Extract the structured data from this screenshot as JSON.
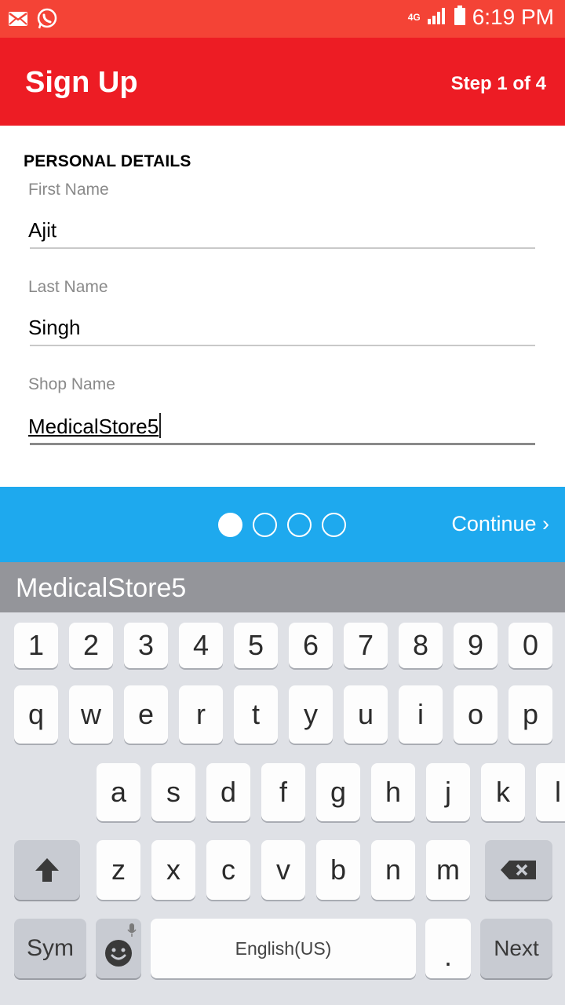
{
  "status_bar": {
    "time": "6:19 PM",
    "network": "4G",
    "left_icons": [
      "mail-icon",
      "whatsapp-icon"
    ],
    "right_icons": [
      "signal-icon",
      "battery-icon"
    ]
  },
  "toolbar": {
    "title": "Sign Up",
    "step": "Step 1 of 4"
  },
  "form": {
    "section_title": "PERSONAL DETAILS",
    "fields": [
      {
        "label": "First Name",
        "value": "Ajit"
      },
      {
        "label": "Last Name",
        "value": "Singh"
      },
      {
        "label": "Shop Name",
        "value": "MedicalStore5"
      }
    ]
  },
  "pager": {
    "total_steps": 4,
    "current_step": 1,
    "continue_label": "Continue ›"
  },
  "suggestion": {
    "text": "MedicalStore5"
  },
  "keyboard": {
    "row_numbers": [
      "1",
      "2",
      "3",
      "4",
      "5",
      "6",
      "7",
      "8",
      "9",
      "0"
    ],
    "row_top": [
      "q",
      "w",
      "e",
      "r",
      "t",
      "y",
      "u",
      "i",
      "o",
      "p"
    ],
    "row_middle": [
      "a",
      "s",
      "d",
      "f",
      "g",
      "h",
      "j",
      "k",
      "l"
    ],
    "row_bottom": [
      "z",
      "x",
      "c",
      "v",
      "b",
      "n",
      "m"
    ],
    "sym_label": "Sym",
    "space_label": "English(US)",
    "period_label": ".",
    "next_label": "Next"
  },
  "colors": {
    "status_bar": "#f44336",
    "toolbar": "#ed1c24",
    "pager_bar": "#1ea9ee",
    "suggestion_bar": "#94959a",
    "keyboard_bg": "#dfe1e6"
  }
}
